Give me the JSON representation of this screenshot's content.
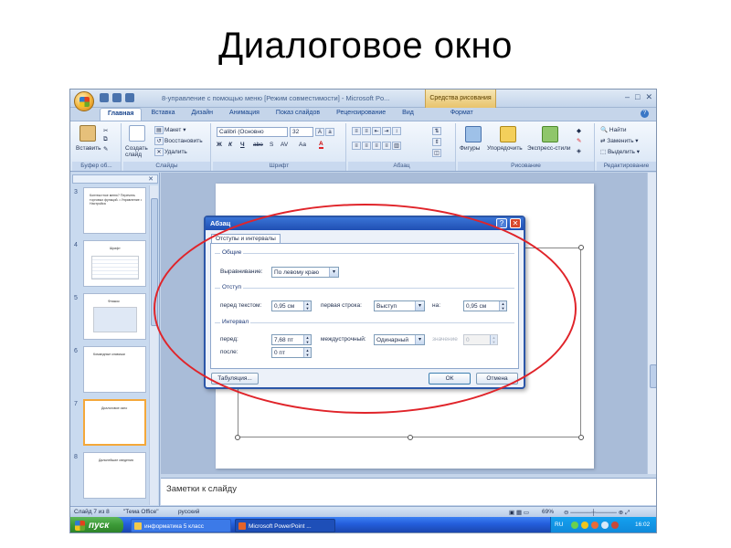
{
  "slide_title": "Диалоговое окно",
  "window": {
    "title": "8-управление с помощью меню [Режим совместимости] - Microsoft Po...",
    "context_tab": "Средства рисования"
  },
  "ribbon_tabs": [
    "Главная",
    "Вставка",
    "Дизайн",
    "Анимация",
    "Показ слайдов",
    "Рецензирование",
    "Вид",
    "Формат"
  ],
  "ribbon": {
    "clipboard": {
      "paste": "Вставить",
      "label": "Буфер об..."
    },
    "slides": {
      "new_slide": "Создать слайд",
      "layout": "Макет",
      "reset": "Восстановить",
      "delete": "Удалить",
      "label": "Слайды"
    },
    "font": {
      "name": "Calibri (Основно",
      "size": "32",
      "bold": "Ж",
      "italic": "К",
      "underline": "Ч",
      "strike": "abe",
      "spacing": "AV",
      "case": "Aa",
      "color": "A",
      "label": "Шрифт"
    },
    "paragraph": {
      "label": "Абзац"
    },
    "drawing": {
      "shapes": "Фигуры",
      "arrange": "Упорядочить",
      "styles": "Экспресс-стили",
      "label": "Рисование"
    },
    "editing": {
      "find": "Найти",
      "replace": "Заменить",
      "select": "Выделить",
      "label": "Редактирование"
    }
  },
  "thumbnails": [
    {
      "num": "3",
      "text": "Контекстное меню? Перечень торговых функций. • Управление • Настройка"
    },
    {
      "num": "4",
      "text": "Шрифт"
    },
    {
      "num": "5",
      "text": "Флажок"
    },
    {
      "num": "6",
      "text": "Командные клавиши"
    },
    {
      "num": "7",
      "text": "Диалоговое окно"
    },
    {
      "num": "8",
      "text": "Дальнейшие сведения"
    }
  ],
  "notes_placeholder": "Заметки к слайду",
  "status": {
    "slide": "Слайд 7 из 8",
    "theme": "\"Тема Office\"",
    "lang": "русский",
    "zoom": "69%"
  },
  "taskbar": {
    "start": "пуск",
    "tasks": [
      "информатика 5 класс",
      "Microsoft PowerPoint ..."
    ],
    "lang": "RU",
    "clock": "16:02"
  },
  "dialog": {
    "title": "Абзац",
    "tab": "Отступы и интервалы",
    "general": {
      "legend": "Общие",
      "align_label": "Выравнивание:",
      "align_value": "По левому краю"
    },
    "indent": {
      "legend": "Отступ",
      "before_label": "перед текстом:",
      "before_value": "0,95 см",
      "first_label": "первая строка:",
      "first_value": "Выступ",
      "by_label": "на:",
      "by_value": "0,95 см"
    },
    "spacing": {
      "legend": "Интервал",
      "before_label": "перед:",
      "before_value": "7,68 пт",
      "after_label": "после:",
      "after_value": "0 пт",
      "line_label": "междустрочный:",
      "line_value": "Одинарный",
      "value_label": "значение",
      "value_value": "0"
    },
    "tabs_button": "Табуляция...",
    "ok": "ОК",
    "cancel": "Отмена"
  },
  "colors": {
    "ellipse": "#e0242a",
    "accent": "#1f4fb3"
  }
}
